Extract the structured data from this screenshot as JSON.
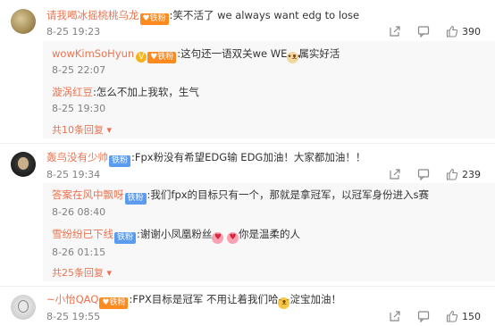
{
  "comments": [
    {
      "author": "请我喝冰摇桃桃乌龙",
      "badge": "♥铁粉",
      "text": ":笑不活了 we always want edg to lose",
      "date": "8-25 19:23",
      "likes": "390",
      "replies": [
        {
          "author": "wowKimSoHyun",
          "badge": "♥铁粉",
          "text_before": ":这句还一语双关we WE",
          "text_after": "属实好活",
          "date": "8-25 22:07"
        },
        {
          "author": "漩涡红豆",
          "text": ":怎么不加上我软，生气",
          "date": "8-25 19:30"
        }
      ],
      "more": "共10条回复"
    },
    {
      "author": "轰鸟没有少帅",
      "badge": "铁粉",
      "text": ":Fpx粉没有希望EDG输 EDG加油！大家都加油！！",
      "date": "8-25 19:34",
      "likes": "239",
      "replies": [
        {
          "author": "答案在风中飘呀",
          "badge": "铁粉",
          "text": ":我们fpx的目标只有一个，那就是拿冠军，以冠军身份进入s赛",
          "date": "8-26 08:40"
        },
        {
          "author": "雪纷纷已下线",
          "badge": "铁粉",
          "text_before": ":谢谢小凤凰粉丝",
          "text_after": "你是温柔的人",
          "date": "8-26 01:15"
        }
      ],
      "more": "共25条回复"
    },
    {
      "author": "~小怡QAQ",
      "badge": "♥铁粉",
      "text_before": ":FPX目标是冠军 不用让着我们哈",
      "text_after": "淀宝加油！",
      "date": "8-25 19:55",
      "likes": "150"
    }
  ],
  "icons": [
    "share-icon",
    "comment-icon",
    "like-icon"
  ],
  "colors": {
    "username": "#eb7350",
    "fans_badge": "#ff8a1f",
    "blue_badge": "#5b9bf0"
  }
}
